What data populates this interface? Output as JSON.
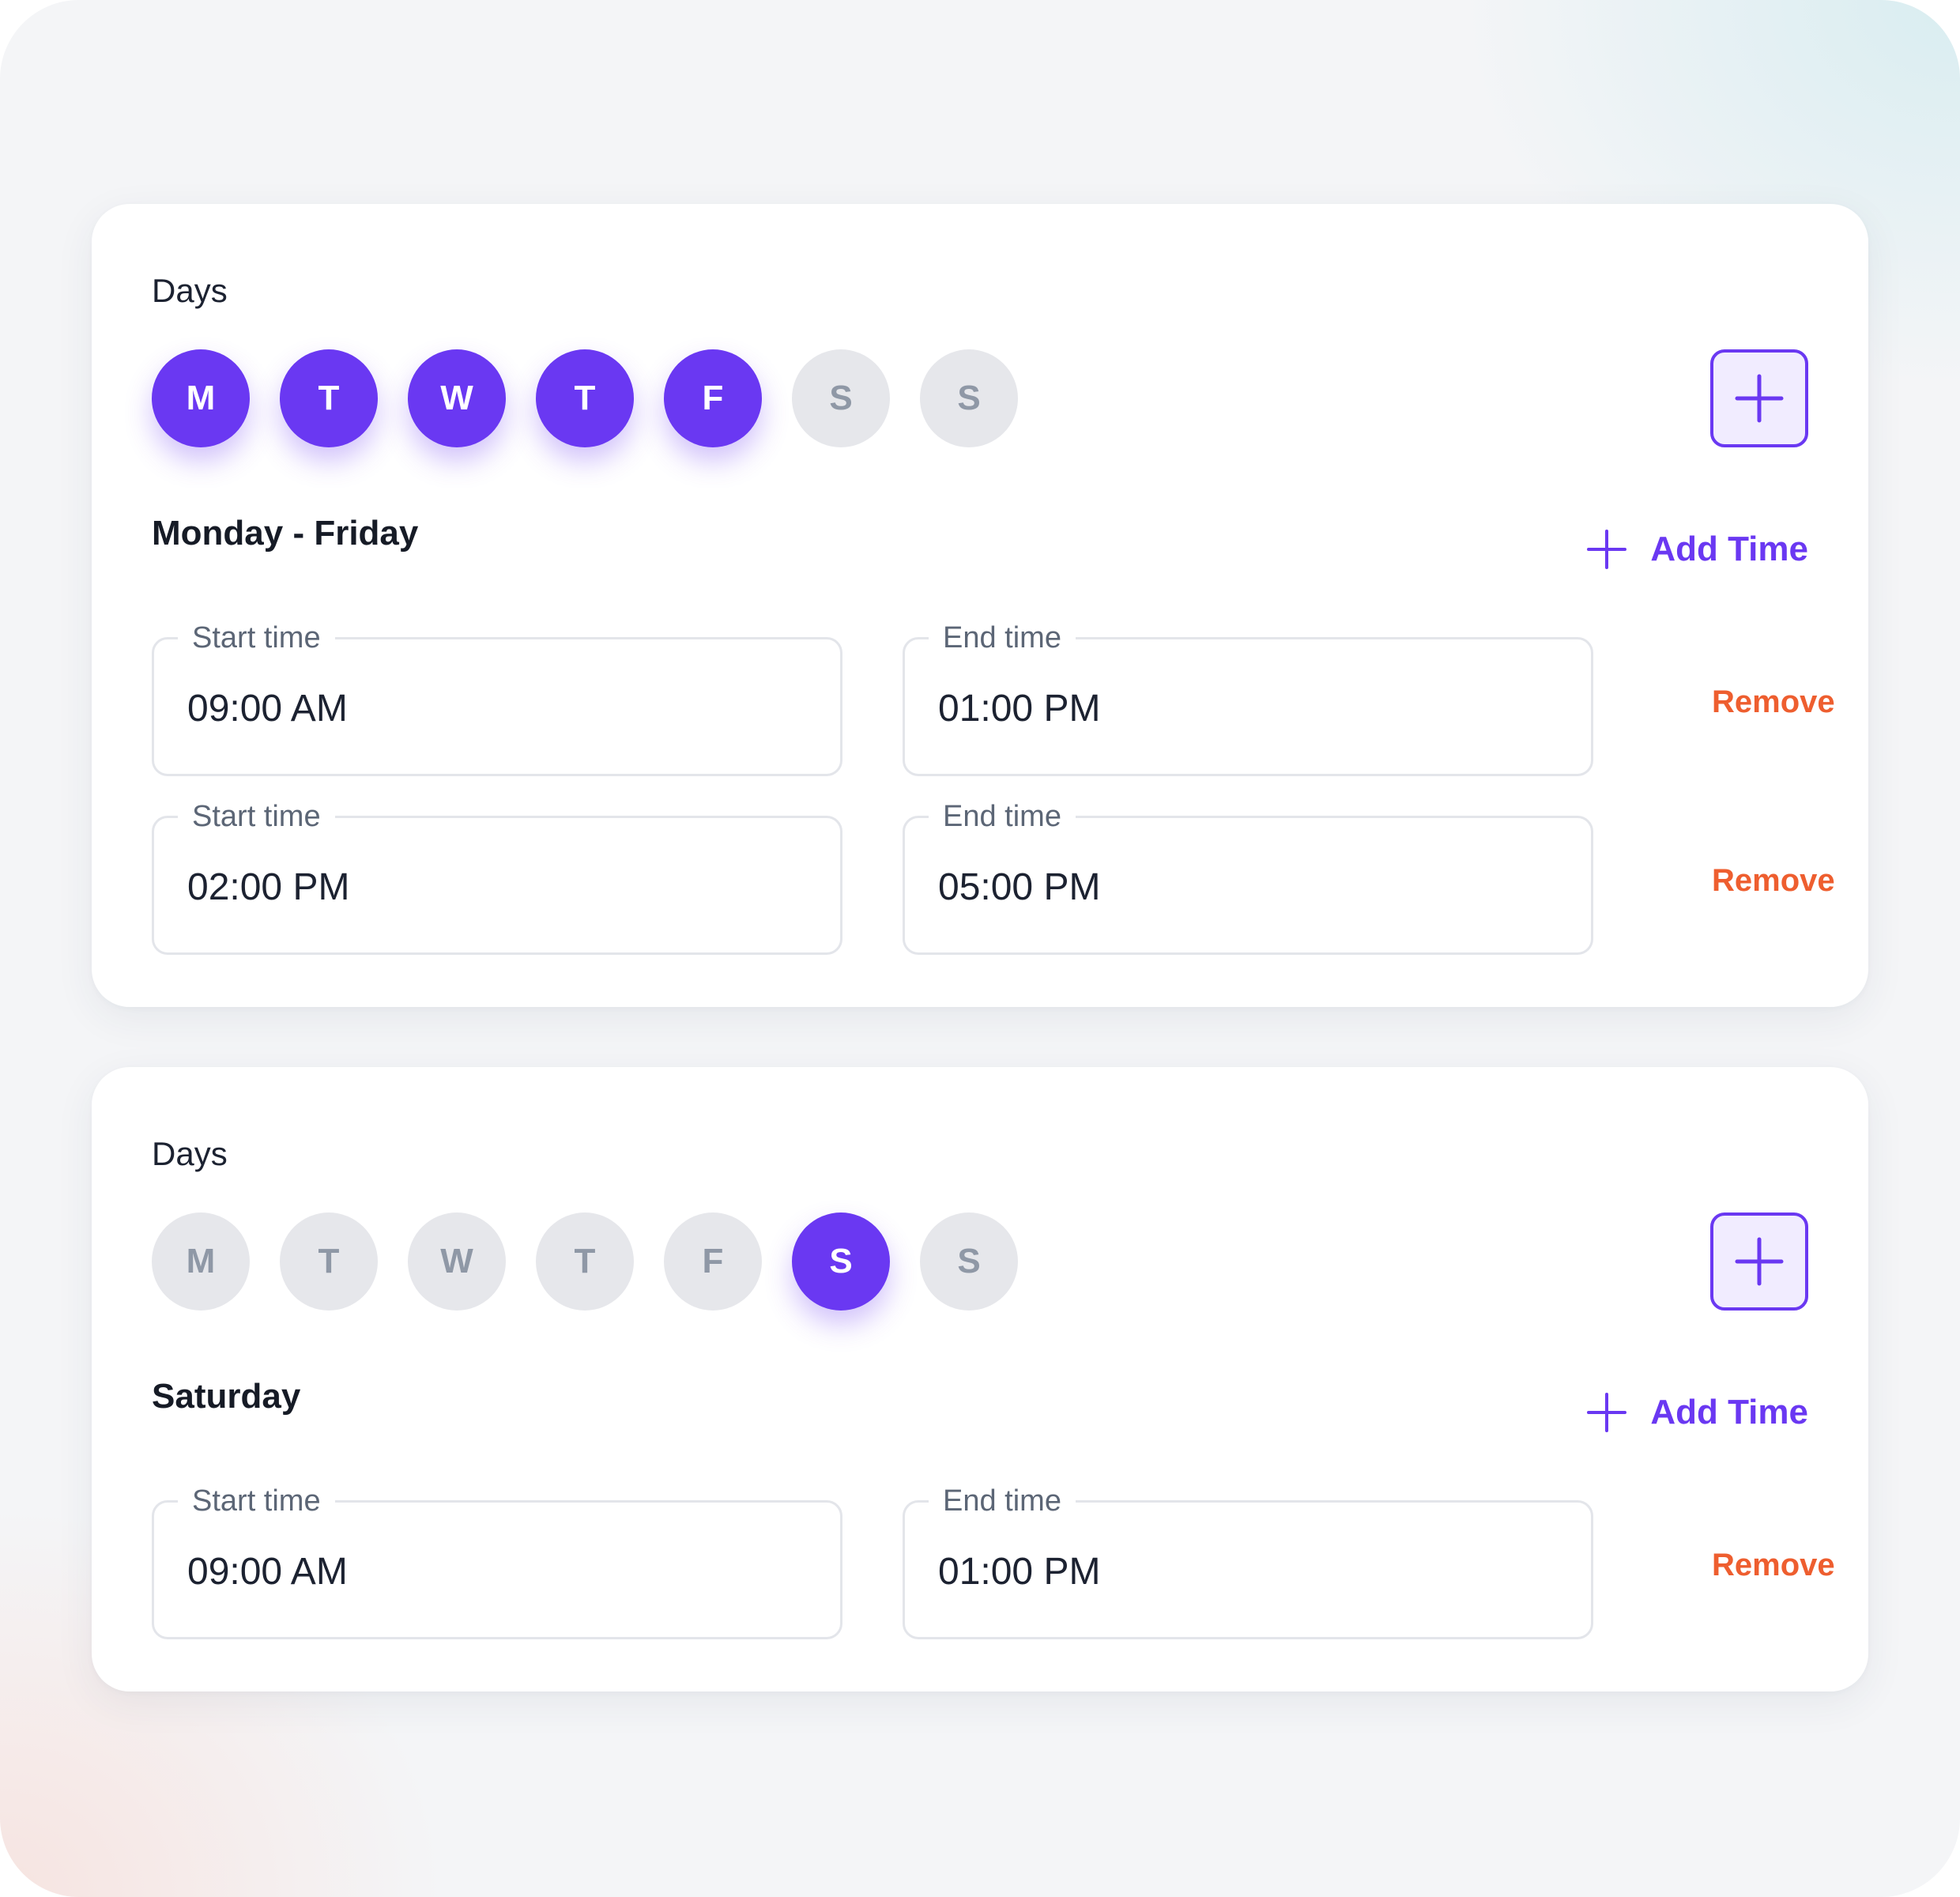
{
  "colors": {
    "accent": "#6a38f2",
    "accent_light": "#f1ecff",
    "inactive_day_bg": "#e6e7eb",
    "inactive_day_text": "#8f98a6",
    "remove": "#ee5e2f",
    "background": "#f4f5f7",
    "card": "#ffffff"
  },
  "schedules": [
    {
      "days_label": "Days",
      "days": [
        {
          "letter": "M",
          "selected": true
        },
        {
          "letter": "T",
          "selected": true
        },
        {
          "letter": "W",
          "selected": true
        },
        {
          "letter": "T",
          "selected": true
        },
        {
          "letter": "F",
          "selected": true
        },
        {
          "letter": "S",
          "selected": false
        },
        {
          "letter": "S",
          "selected": false
        }
      ],
      "add_icon": "plus-icon",
      "title": "Monday - Friday",
      "add_time_label": "Add Time",
      "slots": [
        {
          "start_label": "Start time",
          "start": "09:00 AM",
          "end_label": "End time",
          "end": "01:00 PM",
          "remove_label": "Remove"
        },
        {
          "start_label": "Start time",
          "start": "02:00 PM",
          "end_label": "End time",
          "end": "05:00 PM",
          "remove_label": "Remove"
        }
      ]
    },
    {
      "days_label": "Days",
      "days": [
        {
          "letter": "M",
          "selected": false
        },
        {
          "letter": "T",
          "selected": false
        },
        {
          "letter": "W",
          "selected": false
        },
        {
          "letter": "T",
          "selected": false
        },
        {
          "letter": "F",
          "selected": false
        },
        {
          "letter": "S",
          "selected": true
        },
        {
          "letter": "S",
          "selected": false
        }
      ],
      "add_icon": "plus-icon",
      "title": "Saturday",
      "add_time_label": "Add Time",
      "slots": [
        {
          "start_label": "Start time",
          "start": "09:00 AM",
          "end_label": "End time",
          "end": "01:00 PM",
          "remove_label": "Remove"
        }
      ]
    }
  ]
}
